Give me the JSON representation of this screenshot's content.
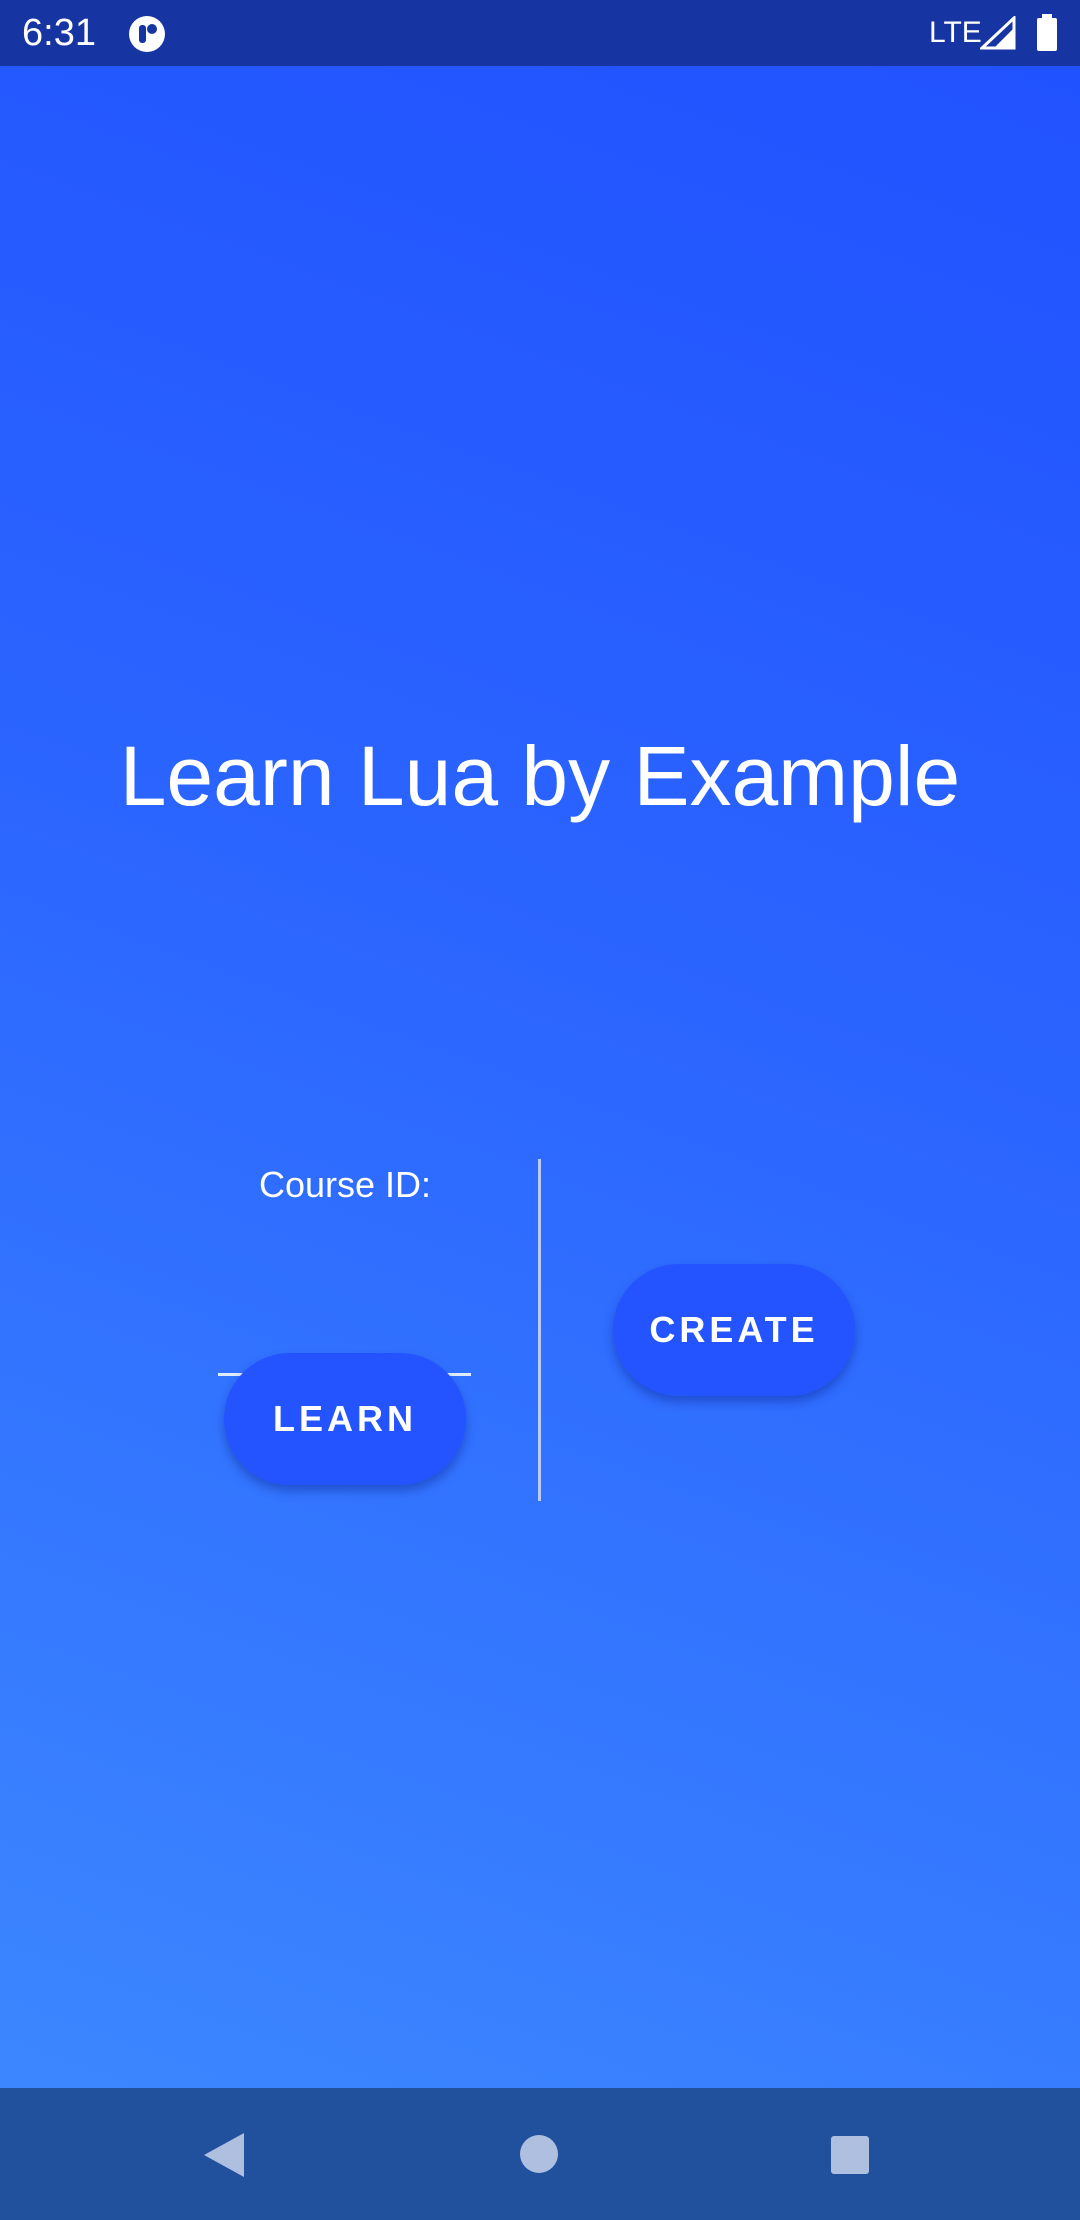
{
  "status_bar": {
    "time": "6:31",
    "network": "LTE",
    "icons": [
      "app-notification-icon",
      "signal-icon",
      "battery-icon"
    ]
  },
  "main": {
    "title": "Learn Lua by Example",
    "course_label": "Course ID:",
    "course_input_value": "",
    "learn_button": "LEARN",
    "create_button": "CREATE"
  },
  "nav_bar": {
    "icons": [
      "back-icon",
      "home-icon",
      "recents-icon"
    ]
  },
  "colors": {
    "status_bar": "#1734a3",
    "background_top": "#2152ff",
    "background_bottom": "#3c87ff",
    "button": "#2454ff",
    "nav_bar": "#21509d",
    "text": "#ffffff"
  }
}
